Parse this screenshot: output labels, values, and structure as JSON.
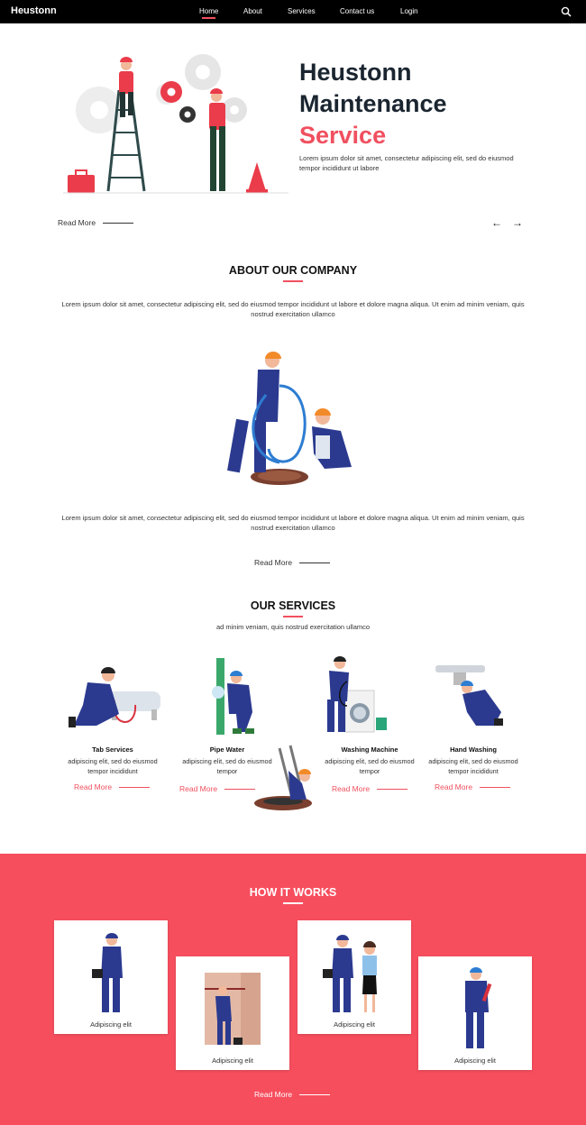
{
  "nav": {
    "brand": "Heustonn",
    "links": [
      {
        "label": "Home",
        "active": true
      },
      {
        "label": "About"
      },
      {
        "label": "Services"
      },
      {
        "label": "Contact us"
      },
      {
        "label": "Login"
      }
    ],
    "search_icon": "search-icon"
  },
  "hero": {
    "title_line1": "Heustonn",
    "title_line2": "Maintenance",
    "title_line3": "Service",
    "text": "Lorem ipsum dolor sit amet, consectetur adipiscing elit, sed do eiusmod tempor incididunt ut labore",
    "read_more": "Read More",
    "prev_icon": "arrow-left-icon",
    "next_icon": "arrow-right-icon"
  },
  "about": {
    "title": "ABOUT OUR COMPANY",
    "para1": "Lorem ipsum dolor sit amet, consectetur adipiscing elit, sed do eiusmod tempor incididunt ut labore et dolore magna aliqua. Ut enim ad minim veniam, quis nostrud exercitation ullamco",
    "para2": "Lorem ipsum dolor sit amet, consectetur adipiscing elit, sed do eiusmod tempor incididunt ut labore et dolore magna aliqua. Ut enim ad minim veniam, quis nostrud exercitation ullamco",
    "read_more": "Read More"
  },
  "services": {
    "title": "OUR SERVICES",
    "subtitle": "ad minim veniam, quis nostrud exercitation ullamco",
    "items": [
      {
        "name": "Tab Services",
        "desc": "adipiscing elit, sed do eiusmod tempor incididunt",
        "read_more": "Read More"
      },
      {
        "name": "Pipe Water",
        "desc": "adipiscing elit, sed do eiusmod tempor",
        "read_more": "Read More"
      },
      {
        "name": "Washing Machine",
        "desc": "adipiscing elit, sed do eiusmod tempor",
        "read_more": "Read More"
      },
      {
        "name": "Hand Washing",
        "desc": "adipiscing elit, sed do eiusmod tempor incididunt",
        "read_more": "Read More"
      }
    ]
  },
  "how": {
    "title": "HOW IT WORKS",
    "cards": [
      {
        "caption": "Adipiscing elit"
      },
      {
        "caption": "Adipiscing elit"
      },
      {
        "caption": "Adipiscing elit"
      },
      {
        "caption": "Adipiscing elit"
      }
    ],
    "read_more": "Read More"
  },
  "colors": {
    "accent": "#f0505f",
    "how_bg": "#f74e5e",
    "worker_blue": "#2b3a8f",
    "nav_bg": "#000000"
  }
}
